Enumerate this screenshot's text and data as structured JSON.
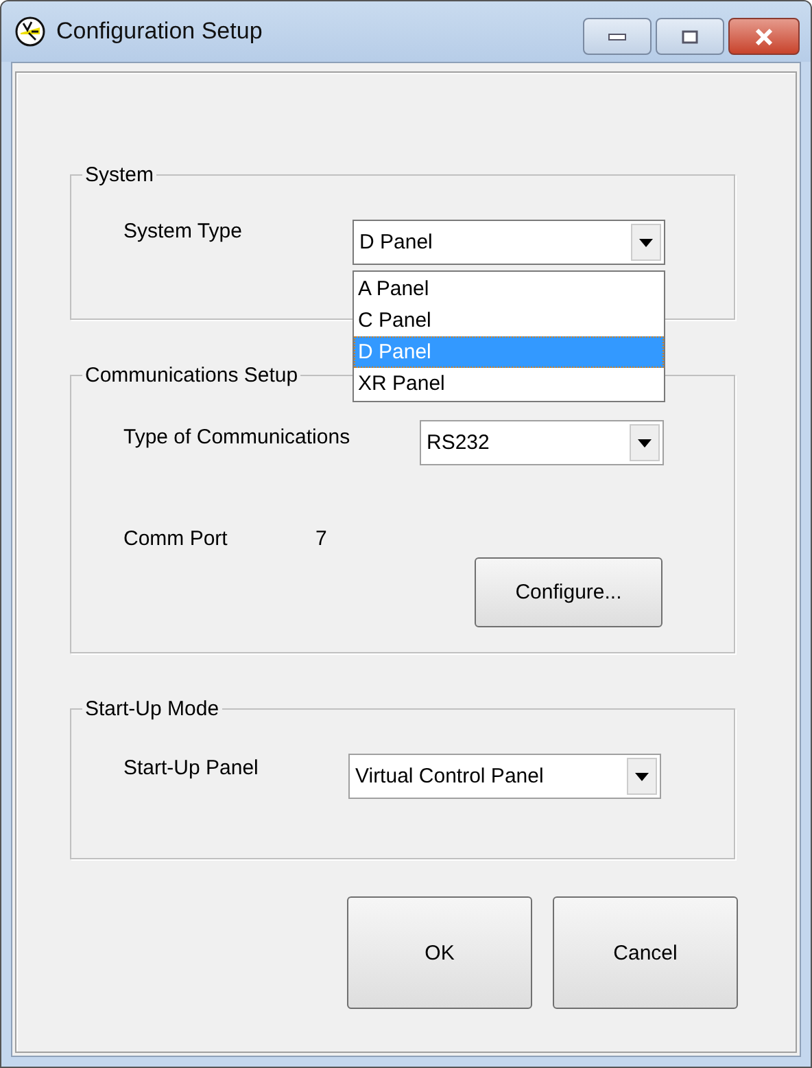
{
  "window": {
    "title": "Configuration Setup"
  },
  "system": {
    "title": "System",
    "system_type": {
      "label": "System Type",
      "value": "D Panel",
      "expanded": true,
      "options": [
        {
          "label": "A Panel",
          "selected": false
        },
        {
          "label": "C Panel",
          "selected": false
        },
        {
          "label": "D Panel",
          "selected": true
        },
        {
          "label": "XR Panel",
          "selected": false
        }
      ]
    }
  },
  "communications": {
    "title": "Communications Setup",
    "type": {
      "label": "Type of Communications",
      "value": "RS232"
    },
    "comm_port": {
      "label": "Comm Port",
      "value": "7"
    },
    "configure_button": "Configure..."
  },
  "startup": {
    "title": "Start-Up Mode",
    "panel": {
      "label": "Start-Up Panel",
      "value": "Virtual Control Panel"
    }
  },
  "buttons": [
    "OK",
    "Cancel"
  ]
}
